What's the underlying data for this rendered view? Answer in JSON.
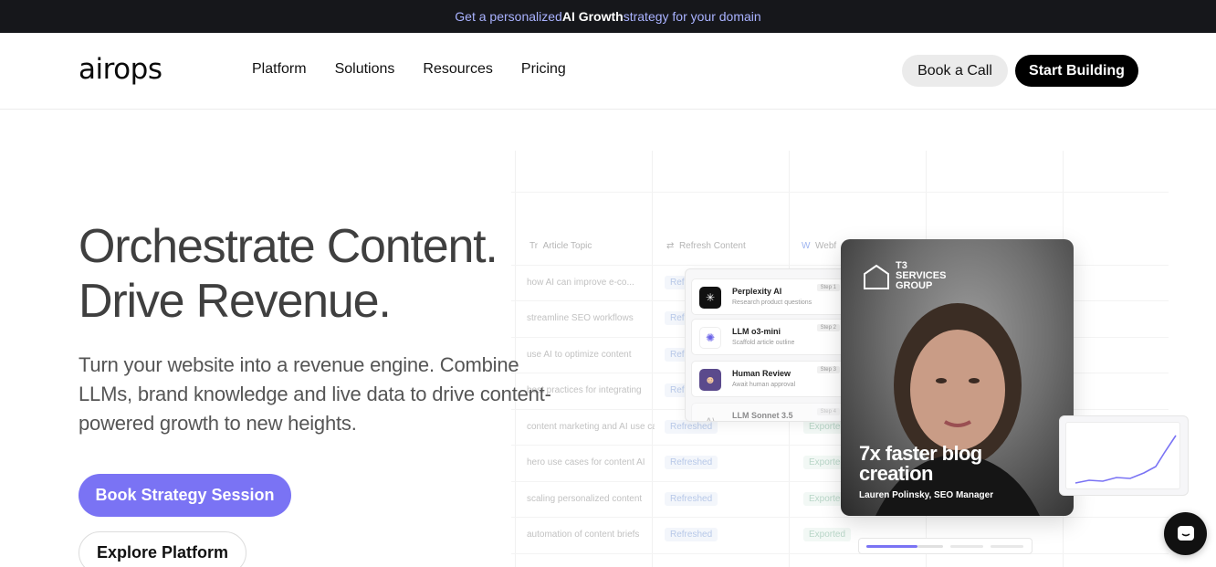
{
  "banner": {
    "pre": "Get a personalized ",
    "bold": "AI Growth",
    "post": " strategy for your domain"
  },
  "header": {
    "logo": "airops",
    "nav": [
      "Platform",
      "Solutions",
      "Resources",
      "Pricing"
    ],
    "book_call": "Book a Call",
    "start_building": "Start Building"
  },
  "hero": {
    "title_line1": "Orchestrate Content.",
    "title_line2": "Drive Revenue.",
    "subtitle": "Turn your website into a revenue engine. Combine LLMs, brand knowledge and live data to drive content-powered growth to new heights.",
    "cta_primary": "Book Strategy Session",
    "cta_secondary": "Explore Platform"
  },
  "table": {
    "columns": [
      "Article Topic",
      "Refresh Content",
      "Webf"
    ],
    "rows": [
      {
        "topic": "how AI can improve e-co...",
        "refresh": "Refr",
        "export": ""
      },
      {
        "topic": "streamline SEO workflows",
        "refresh": "Refr",
        "export": ""
      },
      {
        "topic": "use AI to optimize content",
        "refresh": "Refr",
        "export": ""
      },
      {
        "topic": "best practices for integrating",
        "refresh": "Refr",
        "export": ""
      },
      {
        "topic": "content marketing and AI use cases",
        "refresh": "Refreshed",
        "export": "Exported"
      },
      {
        "topic": "hero use cases for content AI",
        "refresh": "Refreshed",
        "export": "Exported"
      },
      {
        "topic": "scaling personalized content",
        "refresh": "Refreshed",
        "export": "Exported"
      },
      {
        "topic": "automation of content briefs",
        "refresh": "Refreshed",
        "export": "Exported"
      }
    ]
  },
  "workflow": {
    "steps": [
      {
        "name": "Perplexity AI",
        "desc": "Research product questions",
        "tag": "Step 1",
        "icon": "perplexity-icon"
      },
      {
        "name": "LLM o3-mini",
        "desc": "Scaffold article outline",
        "tag": "Step 2",
        "icon": "openai-icon"
      },
      {
        "name": "Human Review",
        "desc": "Await human approval",
        "tag": "Step 3",
        "icon": "avatar-icon"
      },
      {
        "name": "LLM Sonnet 3.5",
        "desc": "",
        "tag": "Step 4",
        "icon": "anthropic-icon"
      }
    ]
  },
  "testimonial": {
    "logo_line1": "T3",
    "logo_line2": "SERVICES",
    "logo_line3": "GROUP",
    "headline": "7x faster blog creation",
    "author": "Lauren Polinsky, SEO Manager"
  },
  "colors": {
    "accent": "#7a73f4",
    "banner_bg": "#16171b",
    "banner_text": "#a9b2ff"
  }
}
